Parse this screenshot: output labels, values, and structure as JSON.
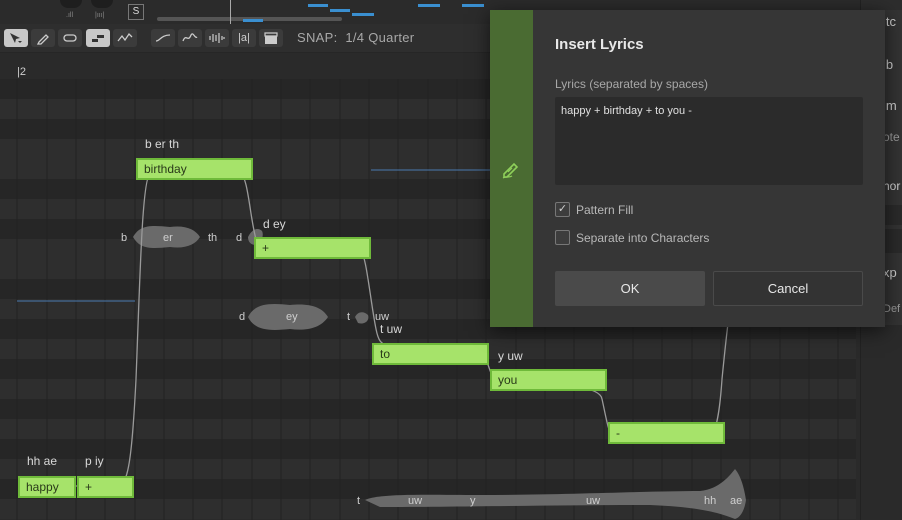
{
  "toolbar": {
    "snap_label": "SNAP:",
    "snap_value": "1/4 Quarter",
    "solo_label": "S"
  },
  "ruler": {
    "bar_label": "2"
  },
  "notes": [
    {
      "lyric": "happy",
      "phonemes": "hh ae"
    },
    {
      "lyric": "+",
      "phonemes": "p iy"
    },
    {
      "lyric": "birthday",
      "phonemes": "b er th"
    },
    {
      "lyric": "+",
      "phonemes": "d ey"
    },
    {
      "lyric": "to",
      "phonemes": "t uw"
    },
    {
      "lyric": "you",
      "phonemes": "y uw"
    },
    {
      "lyric": "-",
      "phonemes": ""
    }
  ],
  "wave_labels": {
    "w1": [
      "b",
      "er",
      "th",
      "d"
    ],
    "w2": [
      "d",
      "ey",
      "t",
      "uw"
    ],
    "w3": [
      "t",
      "uw",
      "y",
      "uw",
      "hh",
      "ae"
    ]
  },
  "right_panel": {
    "items": [
      "itc",
      "ib",
      "im",
      "ote",
      "hor",
      "xp",
      "Def"
    ]
  },
  "dialog": {
    "title": "Insert Lyrics",
    "lyrics_label": "Lyrics (separated by spaces)",
    "lyrics_value": "happy + birthday + to you -",
    "pattern_fill_label": "Pattern Fill",
    "pattern_fill_checked": true,
    "separate_label": "Separate into Characters",
    "separate_checked": false,
    "ok_label": "OK",
    "cancel_label": "Cancel"
  },
  "colors": {
    "note_fill": "#a6e36a",
    "note_border": "#6fba3a",
    "dialog_accent": "#4a6b32",
    "tempo_line": "#4a7ab0"
  }
}
